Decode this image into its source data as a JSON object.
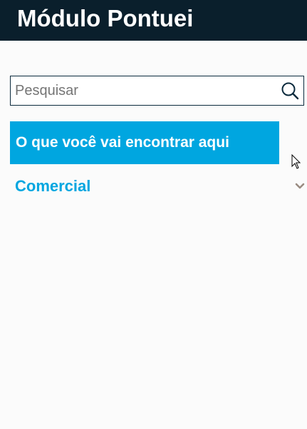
{
  "header": {
    "title": "Módulo Pontuei"
  },
  "search": {
    "placeholder": "Pesquisar",
    "value": "",
    "icon": "search-icon"
  },
  "banner": {
    "label": "O que você vai encontrar aqui"
  },
  "accordion": {
    "label": "Comercial",
    "icon": "chevron-down-icon",
    "expanded": false
  },
  "colors": {
    "header_bg": "#0a1f2c",
    "accent": "#00a6e0",
    "border": "#0b2a3d",
    "chevron": "#9a8c82"
  }
}
